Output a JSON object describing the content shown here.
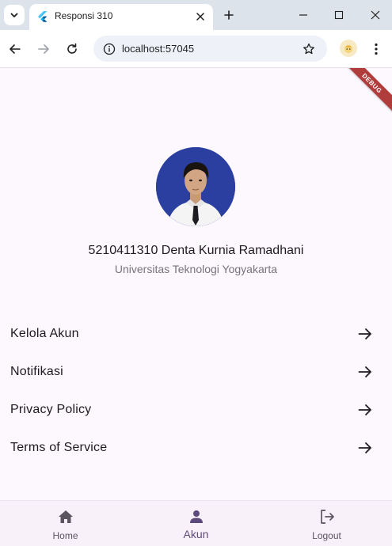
{
  "browser": {
    "tab_title": "Responsi 310",
    "url": "localhost:57045"
  },
  "debug_banner": "DEBUG",
  "profile": {
    "name": "5210411310 Denta Kurnia Ramadhani",
    "affiliation": "Universitas Teknologi Yogyakarta"
  },
  "menu": [
    {
      "label": "Kelola Akun"
    },
    {
      "label": "Notifikasi"
    },
    {
      "label": "Privacy Policy"
    },
    {
      "label": "Terms of Service"
    }
  ],
  "bottom_nav": [
    {
      "label": "Home",
      "icon": "home-icon",
      "selected": false
    },
    {
      "label": "Akun",
      "icon": "person-icon",
      "selected": true
    },
    {
      "label": "Logout",
      "icon": "logout-icon",
      "selected": false
    }
  ],
  "colors": {
    "page_background": "#fdf7fe",
    "accent": "#5b4a7a",
    "debug_banner": "#b13c3c"
  }
}
